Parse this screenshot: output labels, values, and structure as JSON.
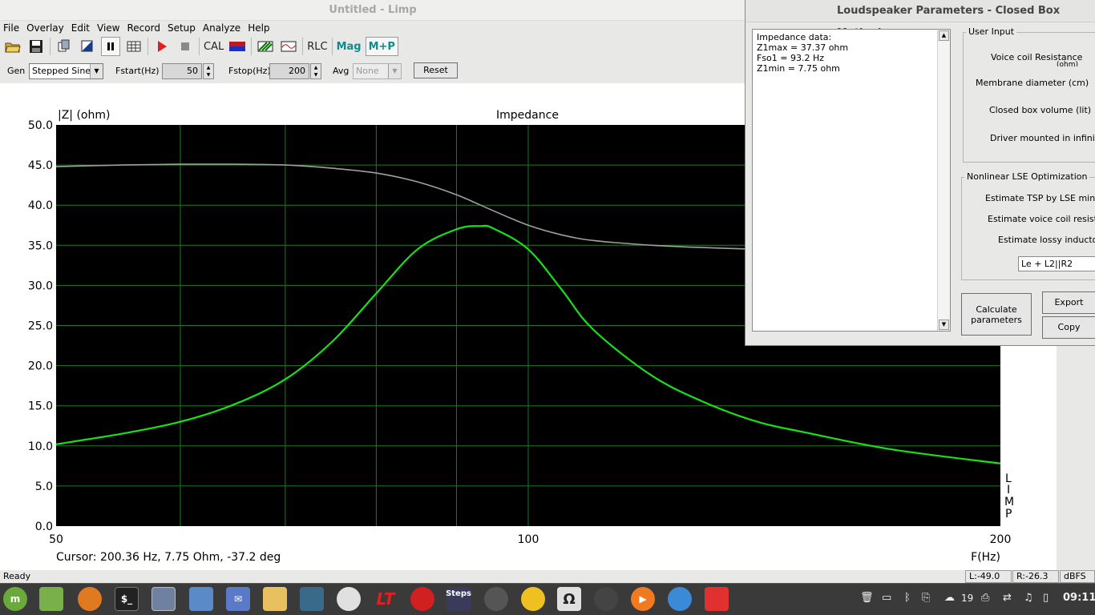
{
  "window": {
    "title": "Untitled - Limp"
  },
  "menu": {
    "items": [
      "File",
      "Overlay",
      "Edit",
      "View",
      "Record",
      "Setup",
      "Analyze",
      "Help"
    ]
  },
  "toolbar": {
    "cal": "CAL",
    "rlc": "RLC",
    "mag": "Mag",
    "mp": "M+P"
  },
  "generator": {
    "gen_label": "Gen",
    "gen_value": "Stepped Sine",
    "fstart_label": "Fstart(Hz)",
    "fstart_value": "50",
    "fstop_label": "Fstop(Hz)",
    "fstop_value": "200",
    "avg_label": "Avg",
    "avg_value": "None",
    "reset": "Reset"
  },
  "plot": {
    "y_title": "|Z| (ohm)",
    "title": "Impedance",
    "x_title": "F(Hz)",
    "watermark": [
      "L",
      "I",
      "M",
      "P"
    ],
    "cursor": "Cursor: 200.36 Hz, 7.75 Ohm, -37.2 deg"
  },
  "chart_data": {
    "type": "line",
    "title": "Impedance",
    "xlabel": "F(Hz)",
    "ylabel": "|Z| (ohm)",
    "x_scale": "log",
    "xlim": [
      50,
      200
    ],
    "ylim": [
      0,
      50
    ],
    "x_ticks": [
      "50",
      "100",
      "200"
    ],
    "y_ticks": [
      "0.0",
      "5.0",
      "10.0",
      "15.0",
      "20.0",
      "25.0",
      "30.0",
      "35.0",
      "40.0",
      "45.0",
      "50.0"
    ],
    "grid": true,
    "series": [
      {
        "color": "#19e019",
        "x": [
          50,
          55,
          60,
          65,
          70,
          75,
          80,
          85,
          90,
          93.2,
          95,
          100,
          105,
          110,
          120,
          130,
          140,
          150,
          170,
          200
        ],
        "y": [
          10.2,
          11.5,
          13.0,
          15.2,
          18.3,
          23.0,
          29.0,
          34.5,
          37.0,
          37.4,
          37.1,
          34.5,
          29.5,
          24.5,
          18.7,
          15.3,
          13.0,
          11.7,
          9.6,
          7.8
        ]
      },
      {
        "color": "#a0a0a0",
        "x": [
          50,
          55,
          60,
          65,
          70,
          75,
          80,
          85,
          90,
          95,
          100,
          105,
          110,
          120,
          130,
          140,
          145
        ],
        "y": [
          44.8,
          45.0,
          45.1,
          45.1,
          45.0,
          44.6,
          44.0,
          42.9,
          41.3,
          39.3,
          37.5,
          36.3,
          35.6,
          35.0,
          34.7,
          34.5,
          34.5
        ]
      }
    ]
  },
  "status": {
    "ready": "Ready",
    "left": "L:-49.0",
    "right": "R:-26.3",
    "unit": "dBFS"
  },
  "dialog": {
    "title": "Loudspeaker Parameters - Closed Box Method",
    "text_lines": [
      "Impedance data:",
      "Z1max =  37.37 ohm",
      "Fso1 = 93.2 Hz",
      "Z1min = 7.75 ohm"
    ],
    "user_input_title": "User Input",
    "labels": [
      "Voice coil Resistance",
      "Membrane diameter (cm)",
      "Closed box volume (lit)",
      "Driver mounted in infinite b"
    ],
    "vc_sub": "(ohm)",
    "lse_title": "Nonlinear LSE Optimization",
    "lse_labels": [
      "Estimate TSP by LSE minimiz",
      "Estimate voice coil resistanc",
      "Estimate lossy inductor m"
    ],
    "model_value": "Le + L2||R2",
    "calculate": "Calculate parameters",
    "export": "Export",
    "copy": "Copy"
  },
  "taskbar": {
    "clock": "09:11",
    "workspace": "19",
    "steps_label": "Steps"
  }
}
